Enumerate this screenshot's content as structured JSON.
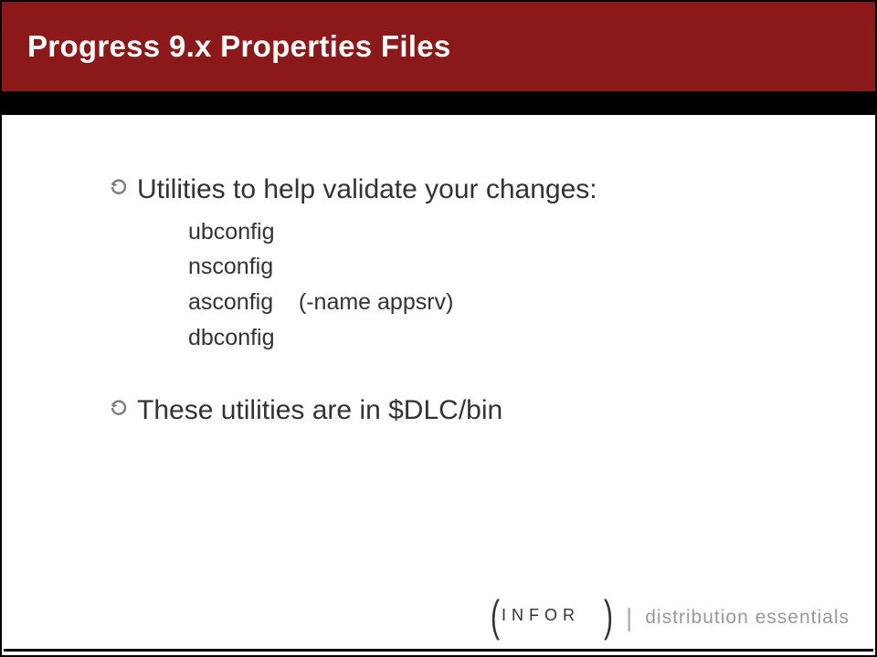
{
  "title": "Progress 9.x Properties Files",
  "bullets": [
    {
      "text": "Utilities to help validate your changes:",
      "sub": [
        "ubconfig",
        "nsconfig",
        "asconfig    (-name appsrv)",
        "dbconfig"
      ]
    },
    {
      "text": "These utilities are in $DLC/bin",
      "sub": []
    }
  ],
  "footer": {
    "logo_text": "I N F O R",
    "separator": "|",
    "tagline": "distribution essentials"
  },
  "colors": {
    "title_bg": "#8b1919",
    "strip": "#000000",
    "bullet_icon": "#7d7d7d",
    "footer_tag": "#999999"
  }
}
